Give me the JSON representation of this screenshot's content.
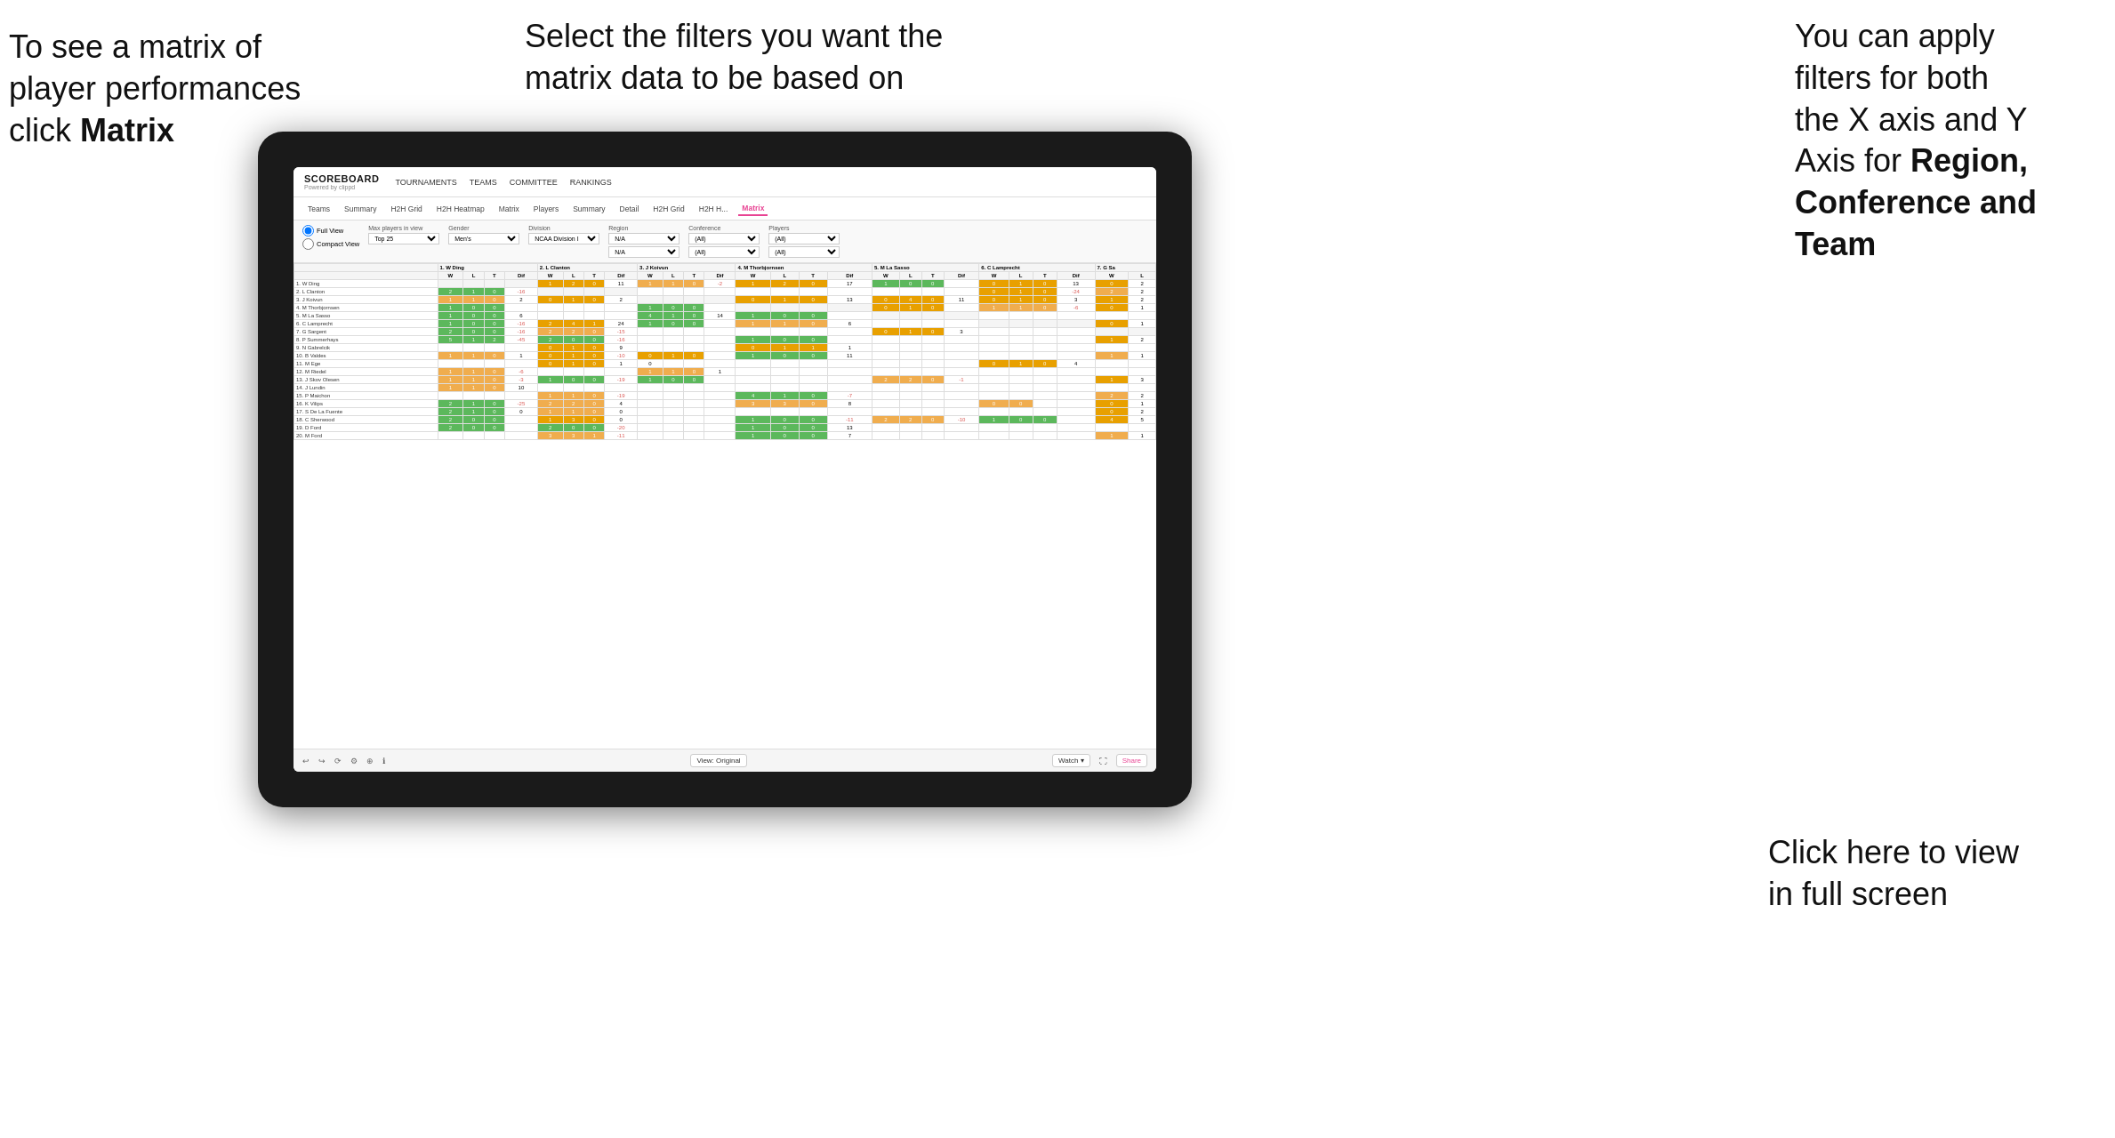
{
  "annotations": {
    "top_left": {
      "line1": "To see a matrix of",
      "line2": "player performances",
      "line3_pre": "click ",
      "line3_bold": "Matrix"
    },
    "top_center": {
      "text": "Select the filters you want the matrix data to be based on"
    },
    "top_right": {
      "line1": "You  can apply",
      "line2": "filters for both",
      "line3": "the X axis and Y",
      "line4_pre": "Axis for ",
      "line4_bold": "Region,",
      "line5_bold": "Conference and",
      "line6_bold": "Team"
    },
    "bottom_right": {
      "line1": "Click here to view",
      "line2": "in full screen"
    }
  },
  "nav": {
    "logo": "SCOREBOARD",
    "logo_sub": "Powered by clippd",
    "items": [
      "TOURNAMENTS",
      "TEAMS",
      "COMMITTEE",
      "RANKINGS"
    ]
  },
  "sub_nav": {
    "items": [
      "Teams",
      "Summary",
      "H2H Grid",
      "H2H Heatmap",
      "Matrix",
      "Players",
      "Summary",
      "Detail",
      "H2H Grid",
      "H2H H...",
      "Matrix"
    ],
    "active": "Matrix"
  },
  "filters": {
    "view_full": "Full View",
    "view_compact": "Compact View",
    "max_players_label": "Max players in view",
    "max_players_value": "Top 25",
    "gender_label": "Gender",
    "gender_value": "Men's",
    "division_label": "Division",
    "division_value": "NCAA Division I",
    "region_label": "Region",
    "region_value": "N/A",
    "conference_label": "Conference",
    "conference_value": "(All)",
    "players_label": "Players",
    "players_value": "(All)"
  },
  "matrix": {
    "col_headers": [
      "1. W Ding",
      "2. L Clanton",
      "3. J Koivun",
      "4. M Thorbjornsen",
      "5. M La Sasso",
      "6. C Lamprecht",
      "7. G Sa"
    ],
    "sub_headers": [
      "W",
      "L",
      "T",
      "Dif"
    ],
    "rows": [
      {
        "name": "1. W Ding",
        "data": [
          [
            null,
            null,
            null,
            null
          ],
          [
            1,
            2,
            0,
            11
          ],
          [
            1,
            1,
            0,
            -2
          ],
          [
            1,
            2,
            0,
            17
          ],
          [
            1,
            0,
            0,
            null
          ],
          [
            0,
            1,
            0,
            13
          ],
          [
            0,
            2
          ]
        ]
      },
      {
        "name": "2. L Clanton",
        "data": [
          [
            2,
            1,
            0,
            -16
          ],
          [
            null,
            null,
            null,
            null
          ],
          [
            null,
            null,
            null,
            null
          ],
          [
            null,
            null,
            null,
            null
          ],
          [
            null,
            null,
            null,
            null
          ],
          [
            0,
            1,
            0,
            -24
          ],
          [
            2,
            2
          ]
        ]
      },
      {
        "name": "3. J Koivun",
        "data": [
          [
            1,
            1,
            0,
            2
          ],
          [
            0,
            1,
            0,
            2
          ],
          [
            null,
            null,
            null,
            null
          ],
          [
            0,
            1,
            0,
            13
          ],
          [
            0,
            4,
            0,
            11
          ],
          [
            0,
            1,
            0,
            3
          ],
          [
            1,
            2
          ]
        ]
      },
      {
        "name": "4. M Thorbjornsen",
        "data": [
          [
            1,
            0,
            0,
            null
          ],
          [
            null,
            null,
            null,
            null
          ],
          [
            1,
            0,
            0,
            null
          ],
          [
            null,
            null,
            null,
            null
          ],
          [
            0,
            1,
            0,
            null
          ],
          [
            1,
            1,
            0,
            -6
          ],
          [
            0,
            1
          ]
        ]
      },
      {
        "name": "5. M La Sasso",
        "data": [
          [
            1,
            0,
            0,
            6
          ],
          [
            null,
            null,
            null,
            null
          ],
          [
            4,
            1,
            0,
            14
          ],
          [
            1,
            0,
            0,
            null
          ],
          [
            null,
            null,
            null,
            null
          ],
          [
            null,
            null,
            null,
            null
          ],
          [
            null,
            null
          ]
        ]
      },
      {
        "name": "6. C Lamprecht",
        "data": [
          [
            1,
            0,
            0,
            -16
          ],
          [
            2,
            4,
            1,
            24
          ],
          [
            1,
            0,
            0,
            null
          ],
          [
            1,
            1,
            0,
            6
          ],
          [
            null,
            null,
            null,
            null
          ],
          [
            null,
            null,
            null,
            null
          ],
          [
            0,
            1
          ]
        ]
      },
      {
        "name": "7. G Sargent",
        "data": [
          [
            2,
            0,
            0,
            -16
          ],
          [
            2,
            2,
            0,
            -15
          ],
          [
            null,
            null,
            null,
            null
          ],
          [
            null,
            null,
            null,
            null
          ],
          [
            0,
            1,
            0,
            3
          ],
          [
            null,
            null,
            null,
            null
          ],
          [
            null,
            null
          ]
        ]
      },
      {
        "name": "8. P Summerhays",
        "data": [
          [
            5,
            1,
            2,
            -45
          ],
          [
            2,
            0,
            0,
            -16
          ],
          [
            null,
            null,
            null,
            null
          ],
          [
            1,
            0,
            0,
            null
          ],
          [
            null,
            null,
            null,
            null
          ],
          [
            null,
            null,
            null,
            null
          ],
          [
            1,
            2
          ]
        ]
      },
      {
        "name": "9. N Gabrelcik",
        "data": [
          [
            null,
            null,
            null,
            null
          ],
          [
            0,
            1,
            0,
            9
          ],
          [
            null,
            null,
            null,
            null
          ],
          [
            0,
            1,
            1,
            1
          ],
          [
            null,
            null,
            null,
            null
          ],
          [
            null,
            null,
            null,
            null
          ],
          [
            null,
            null
          ]
        ]
      },
      {
        "name": "10. B Valdes",
        "data": [
          [
            1,
            1,
            0,
            1
          ],
          [
            0,
            1,
            0,
            -10
          ],
          [
            0,
            1,
            0,
            null
          ],
          [
            1,
            0,
            0,
            11
          ],
          [
            null,
            null,
            null,
            null
          ],
          [
            null,
            null,
            null,
            null
          ],
          [
            1,
            1
          ]
        ]
      },
      {
        "name": "11. M Ege",
        "data": [
          [
            null,
            null,
            null,
            null
          ],
          [
            0,
            1,
            0,
            1
          ],
          [
            0,
            null,
            null,
            null
          ],
          [
            null,
            null,
            null,
            null
          ],
          [
            null,
            null,
            null,
            null
          ],
          [
            0,
            1,
            0,
            4
          ],
          [
            null,
            null
          ]
        ]
      },
      {
        "name": "12. M Riedel",
        "data": [
          [
            1,
            1,
            0,
            -6
          ],
          [
            null,
            null,
            null,
            null
          ],
          [
            1,
            1,
            0,
            1
          ],
          [
            null,
            null,
            null,
            null
          ],
          [
            null,
            null,
            null,
            null
          ],
          [
            null,
            null,
            null,
            null
          ],
          [
            null,
            null
          ]
        ]
      },
      {
        "name": "13. J Skov Olesen",
        "data": [
          [
            1,
            1,
            0,
            -3
          ],
          [
            1,
            0,
            0,
            -19
          ],
          [
            1,
            0,
            0,
            null
          ],
          [
            null,
            null,
            null,
            null
          ],
          [
            2,
            2,
            0,
            -1
          ],
          [
            null,
            null,
            null,
            null
          ],
          [
            1,
            3
          ]
        ]
      },
      {
        "name": "14. J Lundin",
        "data": [
          [
            1,
            1,
            0,
            10
          ],
          [
            null,
            null,
            null,
            null
          ],
          [
            null,
            null,
            null,
            null
          ],
          [
            null,
            null,
            null,
            null
          ],
          [
            null,
            null,
            null,
            null
          ],
          [
            null,
            null,
            null,
            null
          ],
          [
            null,
            null
          ]
        ]
      },
      {
        "name": "15. P Maichon",
        "data": [
          [
            null,
            null,
            null,
            null
          ],
          [
            1,
            1,
            0,
            -19
          ],
          [
            null,
            null,
            null,
            null
          ],
          [
            4,
            1,
            0,
            -7
          ],
          [
            null,
            null,
            null,
            null
          ],
          [
            null,
            null,
            null,
            null
          ],
          [
            2,
            2
          ]
        ]
      },
      {
        "name": "16. K Vilips",
        "data": [
          [
            2,
            1,
            0,
            -25
          ],
          [
            2,
            2,
            0,
            4
          ],
          [
            null,
            null,
            null,
            null
          ],
          [
            3,
            3,
            0,
            8
          ],
          [
            null,
            null,
            null,
            null
          ],
          [
            0,
            0,
            null,
            null
          ],
          [
            0,
            1
          ]
        ]
      },
      {
        "name": "17. S De La Fuente",
        "data": [
          [
            2,
            1,
            0,
            0
          ],
          [
            1,
            1,
            0,
            0
          ],
          [
            null,
            null,
            null,
            null
          ],
          [
            null,
            null,
            null,
            null
          ],
          [
            null,
            null,
            null,
            null
          ],
          [
            null,
            null,
            null,
            null
          ],
          [
            0,
            2
          ]
        ]
      },
      {
        "name": "18. C Sherwood",
        "data": [
          [
            2,
            0,
            0,
            null
          ],
          [
            1,
            3,
            0,
            0
          ],
          [
            null,
            null,
            null,
            null
          ],
          [
            1,
            0,
            0,
            -11
          ],
          [
            2,
            2,
            0,
            -10
          ],
          [
            1,
            0,
            0,
            null
          ],
          [
            4,
            5
          ]
        ]
      },
      {
        "name": "19. D Ford",
        "data": [
          [
            2,
            0,
            0,
            null
          ],
          [
            2,
            0,
            0,
            -20
          ],
          [
            null,
            null,
            null,
            null
          ],
          [
            1,
            0,
            0,
            13
          ],
          [
            null,
            null,
            null,
            null
          ],
          [
            null,
            null,
            null,
            null
          ],
          [
            null,
            null
          ]
        ]
      },
      {
        "name": "20. M Ford",
        "data": [
          [
            null,
            null,
            null,
            null
          ],
          [
            3,
            3,
            1,
            -11
          ],
          [
            null,
            null,
            null,
            null
          ],
          [
            1,
            0,
            0,
            7
          ],
          [
            null,
            null,
            null,
            null
          ],
          [
            null,
            null,
            null,
            null
          ],
          [
            1,
            1
          ]
        ]
      }
    ]
  },
  "bottom_bar": {
    "view_label": "View: Original",
    "watch_label": "Watch ▾",
    "share_label": "Share"
  },
  "colors": {
    "accent": "#e84393",
    "green": "#5cb85c",
    "yellow": "#f0ad4e",
    "orange": "#e8a000",
    "red": "#d9534f"
  }
}
